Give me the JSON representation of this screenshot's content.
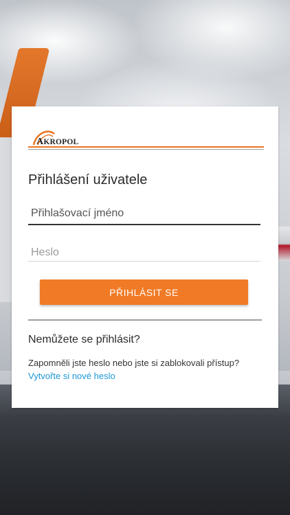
{
  "brand": {
    "logo_first": "A",
    "logo_rest": "KROPOL",
    "accent_color": "#f07a25"
  },
  "login": {
    "title": "Přihlášení uživatele",
    "username_placeholder": "Přihlašovací jméno",
    "password_placeholder": "Heslo",
    "submit_label": "PŘIHLÁSIT SE"
  },
  "help": {
    "title": "Nemůžete se přihlásit?",
    "text": "Zapomněli jste heslo nebo jste si zablokovali přístup?",
    "link_label": "Vytvořte si nové heslo",
    "link_color": "#1e98d7"
  }
}
